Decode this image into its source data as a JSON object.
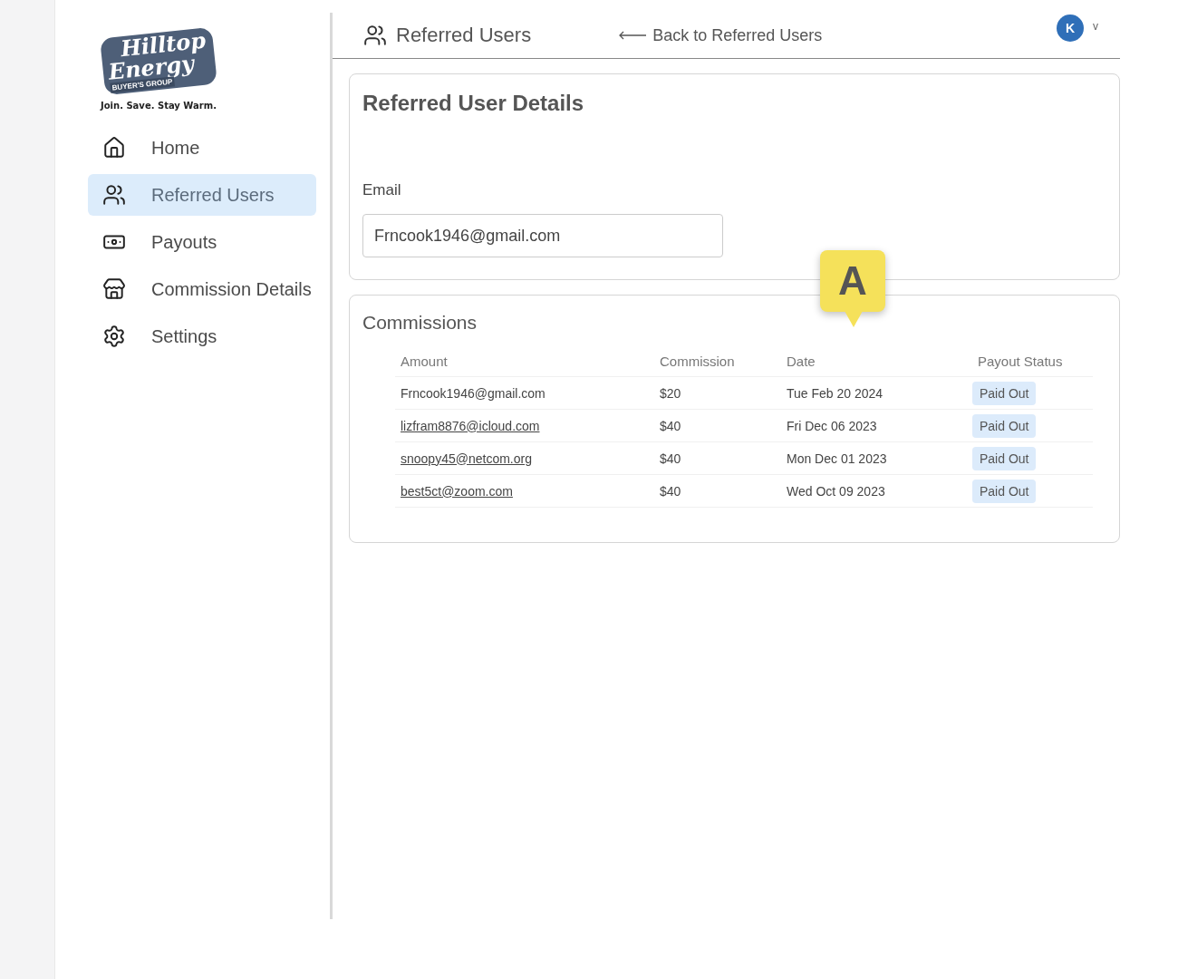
{
  "logo": {
    "line_1": "Hilltop",
    "line_2": "Energy",
    "subtitle": "BUYER'S GROUP",
    "tagline": "Join. Save. Stay Warm."
  },
  "sidebar": {
    "items": [
      {
        "label": "Home",
        "selected": false
      },
      {
        "label": "Referred Users",
        "selected": true
      },
      {
        "label": "Payouts",
        "selected": false
      },
      {
        "label": "Commission Details",
        "selected": false
      },
      {
        "label": "Settings",
        "selected": false
      }
    ]
  },
  "header": {
    "title": "Referred Users",
    "back_link": "Back to Referred Users",
    "avatar": "K",
    "menu_caret": "v"
  },
  "details": {
    "title": "Referred User Details",
    "email_label": "Email",
    "email_value": "Frncook1946@gmail.com"
  },
  "marker": {
    "label": "A"
  },
  "commissions": {
    "title": "Commissions",
    "columns": [
      "Amount",
      "Commission",
      "Date",
      "Payout Status"
    ],
    "rows": [
      {
        "email": "Frncook1946@gmail.com",
        "link": false,
        "commission": "$20",
        "date": "Tue Feb 20 2024",
        "status": "Paid Out"
      },
      {
        "email": "lizfram8876@icloud.com",
        "link": true,
        "commission": "$40",
        "date": "Fri Dec 06 2023",
        "status": "Paid Out"
      },
      {
        "email": "snoopy45@netcom.org",
        "link": true,
        "commission": "$40",
        "date": "Mon Dec 01 2023",
        "status": "Paid Out"
      },
      {
        "email": "best5ct@zoom.com",
        "link": true,
        "commission": "$40",
        "date": "Wed Oct 09 2023",
        "status": "Paid Out"
      }
    ]
  }
}
